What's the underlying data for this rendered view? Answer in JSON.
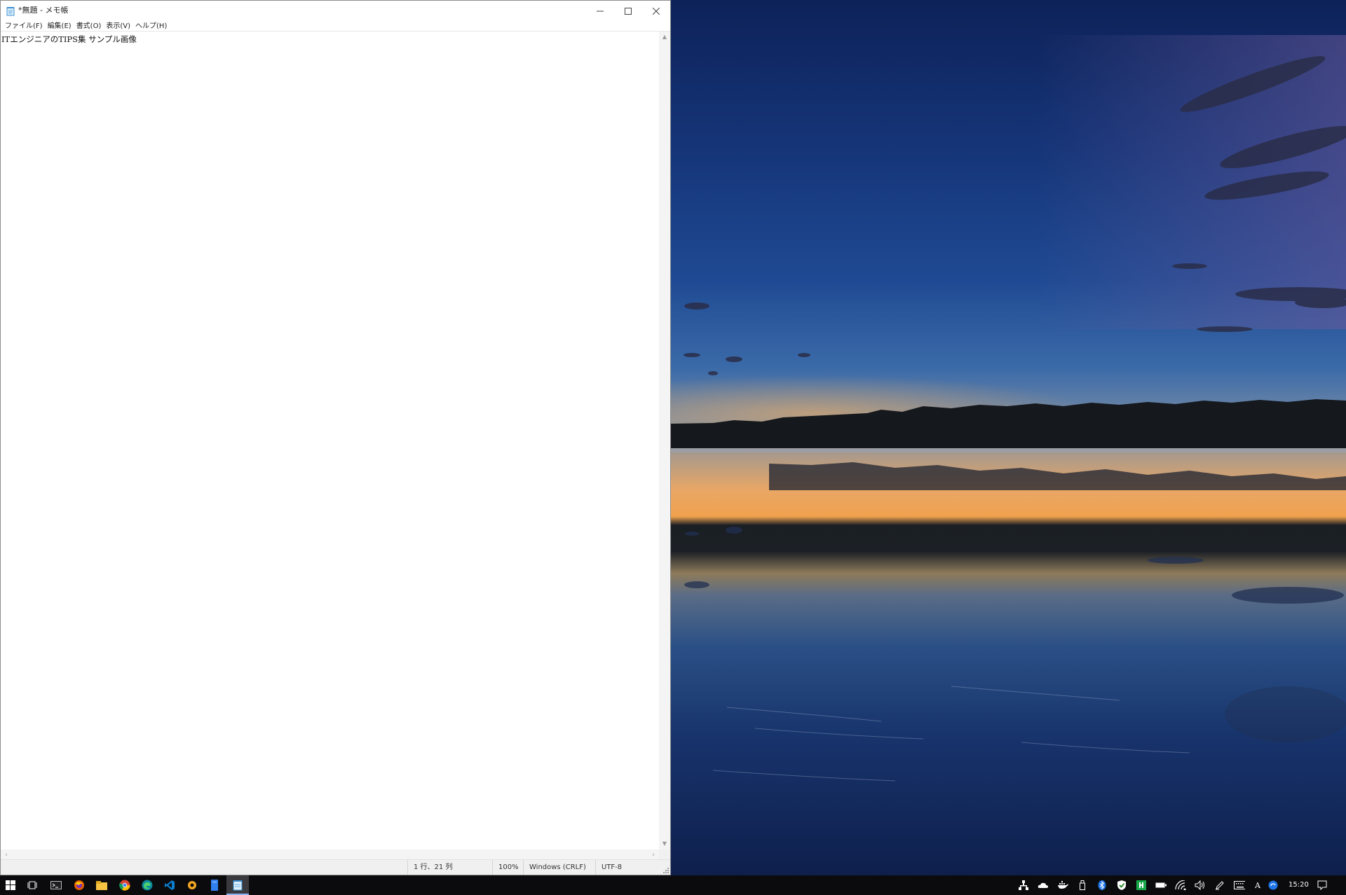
{
  "window": {
    "title": "*無題 - メモ帳",
    "app": "Notepad",
    "controls": {
      "minimize_icon": "minimize-icon",
      "maximize_icon": "maximize-icon",
      "close_icon": "close-icon"
    }
  },
  "menu": {
    "items": [
      {
        "label": "ファイル(F)"
      },
      {
        "label": "編集(E)"
      },
      {
        "label": "書式(O)"
      },
      {
        "label": "表示(V)"
      },
      {
        "label": "ヘルプ(H)"
      }
    ]
  },
  "editor": {
    "content": "ITエンジニアのTIPS集 サンプル画像"
  },
  "statusbar": {
    "position": "1 行、21 列",
    "zoom": "100%",
    "line_ending": "Windows (CRLF)",
    "encoding": "UTF-8"
  },
  "taskbar": {
    "pinned": [
      {
        "name": "start-icon"
      },
      {
        "name": "task-view-icon"
      },
      {
        "name": "terminal-icon"
      },
      {
        "name": "firefox-icon"
      },
      {
        "name": "file-explorer-icon"
      },
      {
        "name": "chrome-icon"
      },
      {
        "name": "edge-icon"
      },
      {
        "name": "vscode-icon"
      },
      {
        "name": "app-orange-icon"
      },
      {
        "name": "app-blue-doc-icon"
      },
      {
        "name": "notepad-icon",
        "active": true
      }
    ],
    "tray": [
      {
        "name": "network-share-icon"
      },
      {
        "name": "onedrive-icon"
      },
      {
        "name": "docker-icon"
      },
      {
        "name": "usb-icon"
      },
      {
        "name": "bluetooth-icon"
      },
      {
        "name": "security-icon"
      },
      {
        "name": "app-green-icon"
      },
      {
        "name": "battery-icon"
      },
      {
        "name": "wifi-icon"
      },
      {
        "name": "volume-icon"
      },
      {
        "name": "pen-icon"
      },
      {
        "name": "keyboard-icon"
      },
      {
        "name": "ime-icon"
      },
      {
        "name": "cloud-sync-icon"
      }
    ],
    "ime_label": "A",
    "clock": "15:20",
    "notification_icon": "notification-icon"
  },
  "colors": {
    "taskbar_bg": "#0b0b0d",
    "window_bg": "#ffffff",
    "status_bg": "#f0f0f0",
    "active_indicator": "#8ab4f8"
  }
}
